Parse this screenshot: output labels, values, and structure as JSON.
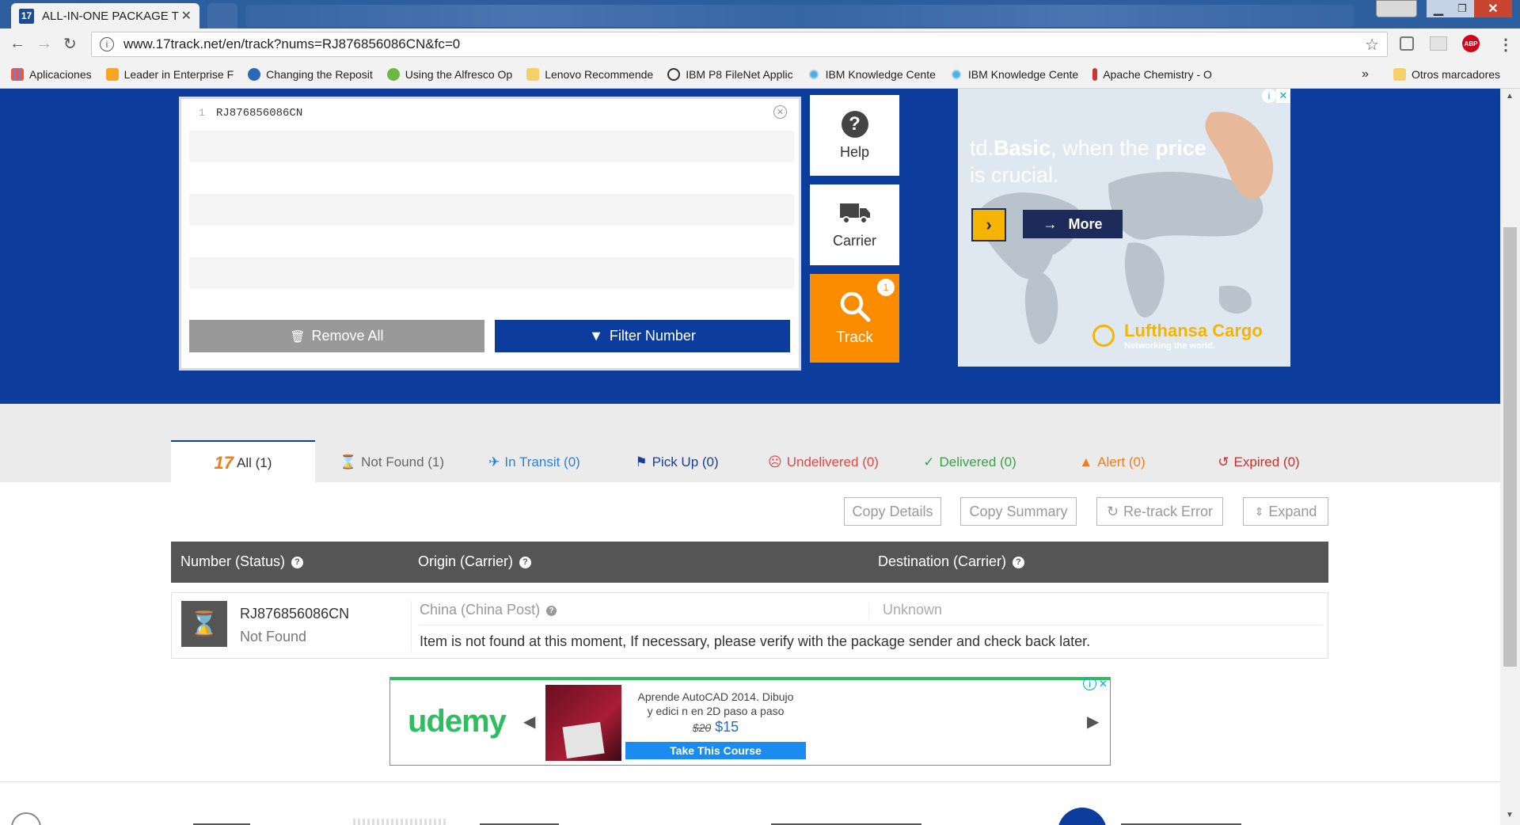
{
  "browser": {
    "active_tab_title": "ALL-IN-ONE PACKAGE T",
    "url": "www.17track.net/en/track?nums=RJ876856086CN&fc=0",
    "bookmarks": [
      "Aplicaciones",
      "Leader in Enterprise F",
      "Changing the Reposit",
      "Using the Alfresco Op",
      "Lenovo Recommende",
      "IBM P8 FileNet Applic",
      "IBM Knowledge Cente",
      "IBM Knowledge Cente",
      "Apache Chemistry - O"
    ],
    "overflow": "»",
    "other_bookmarks": "Otros marcadores",
    "abp_badge": "ABP"
  },
  "tracking_input": {
    "line_number": "1",
    "number": "RJ876856086CN",
    "remove_all_label": "Remove All",
    "filter_label": "Filter Number"
  },
  "side_buttons": {
    "help": "Help",
    "carrier": "Carrier",
    "track": "Track",
    "track_count": "1"
  },
  "ad_top": {
    "headline_pre": "td.",
    "headline_bold1": "Basic",
    "headline_mid": ", when the ",
    "headline_bold2": "price",
    "headline_post": "is crucial.",
    "more_label": "More",
    "brand": "Lufthansa Cargo",
    "tagline": "Networking the world."
  },
  "status_tabs": [
    {
      "label": "All (1)",
      "color": "#333333"
    },
    {
      "label": "Not Found (1)",
      "color": "#666666"
    },
    {
      "label": "In Transit (0)",
      "color": "#2f7fd1"
    },
    {
      "label": "Pick Up (0)",
      "color": "#1a3f8f"
    },
    {
      "label": "Undelivered (0)",
      "color": "#e04646"
    },
    {
      "label": "Delivered (0)",
      "color": "#3aa14a"
    },
    {
      "label": "Alert (0)",
      "color": "#f27b1d"
    },
    {
      "label": "Expired (0)",
      "color": "#c9302c"
    }
  ],
  "actions": {
    "copy_details": "Copy Details",
    "copy_summary": "Copy Summary",
    "retrack": "Re-track Error",
    "expand": "Expand"
  },
  "table": {
    "headers": [
      "Number (Status)",
      "Origin (Carrier)",
      "Destination (Carrier)"
    ],
    "row": {
      "number": "RJ876856086CN",
      "status": "Not Found",
      "origin": "China (China Post)",
      "destination": "Unknown",
      "message": "Item is not found at this moment, If necessary, please verify with the package sender and check back later."
    }
  },
  "ad_bottom": {
    "brand": "udemy",
    "course_line1": "Aprende AutoCAD 2014. Dibujo",
    "course_line2": "y edici n en 2D paso a paso",
    "old_price": "$20",
    "new_price": "$15",
    "cta": "Take This Course"
  },
  "colors": {
    "hero_blue": "#0c3d9c",
    "track_orange": "#fb8c00",
    "filter_blue": "#0c3d9c",
    "header_gray": "#555555"
  }
}
